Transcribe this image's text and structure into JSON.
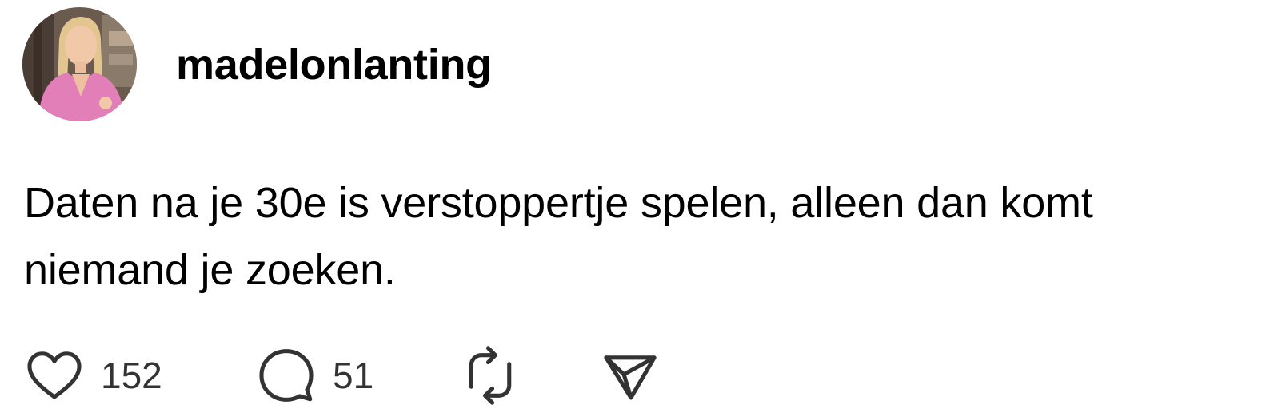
{
  "post": {
    "username": "madelonlanting",
    "text_lines": [
      "Daten na je 30e is verstoppertje spelen, alleen dan komt",
      "niemand je zoeken."
    ]
  },
  "actions": {
    "like": {
      "icon": "heart-icon",
      "count": "152"
    },
    "reply": {
      "icon": "speech-bubble-icon",
      "count": "51"
    },
    "repost": {
      "icon": "repost-icon"
    },
    "share": {
      "icon": "paper-plane-icon"
    }
  },
  "colors": {
    "text": "#000000",
    "icon": "#333333",
    "background": "#ffffff"
  }
}
